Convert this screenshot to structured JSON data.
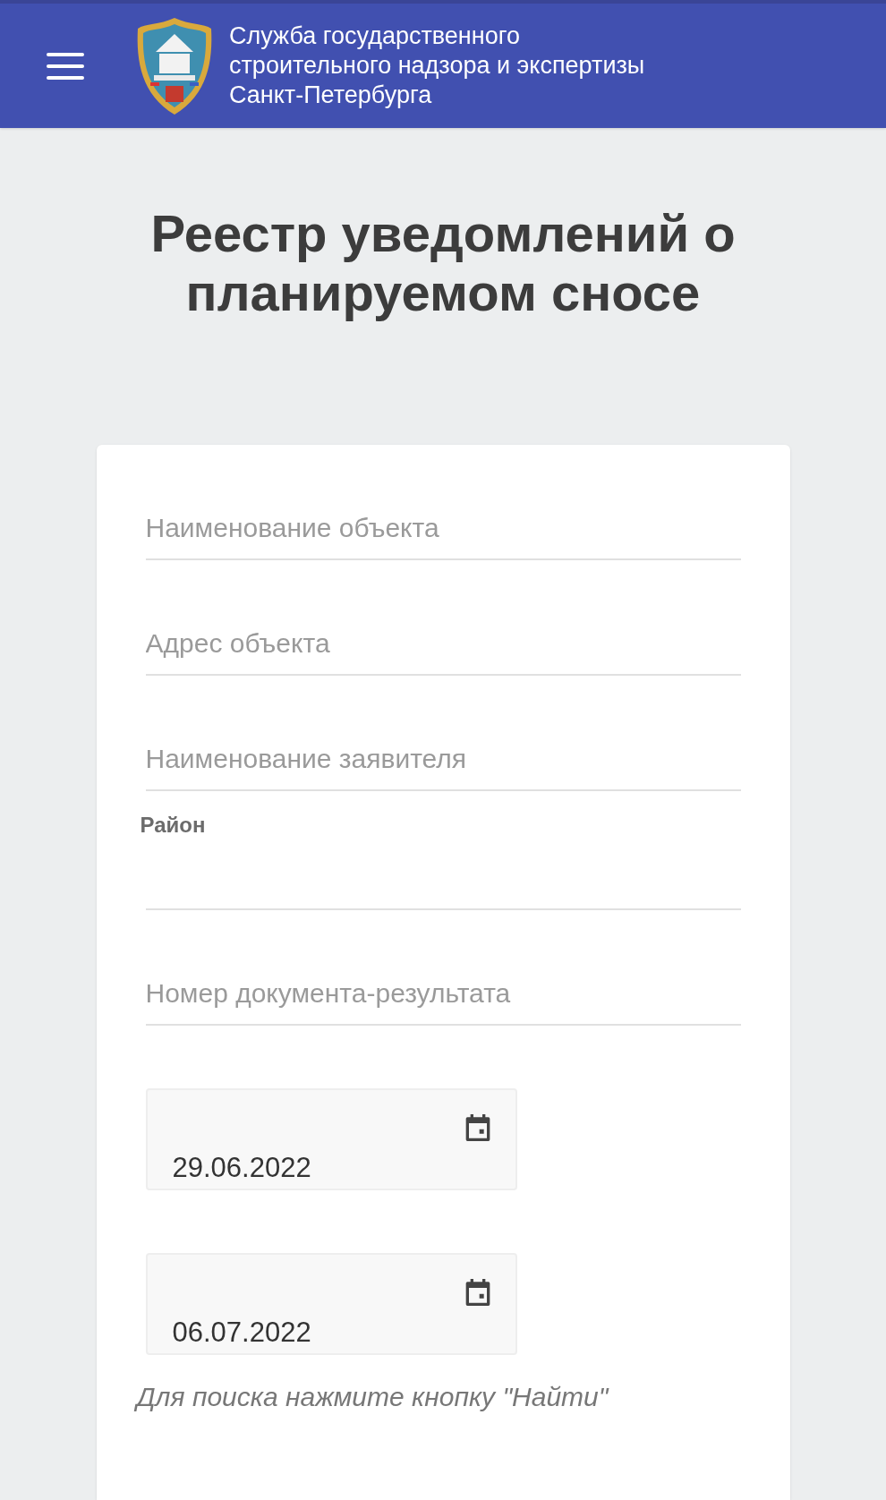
{
  "header": {
    "title_lines": [
      "Служба государственного",
      "строительного надзора и экспертизы",
      "Санкт-Петербурга"
    ]
  },
  "page_title": "Реестр уведомлений о планируемом сносе",
  "form": {
    "fields": [
      {
        "kind": "text",
        "placeholder": "Наименование объекта"
      },
      {
        "kind": "text",
        "placeholder": "Адрес объекта"
      },
      {
        "kind": "text",
        "placeholder": "Наименование заявителя"
      },
      {
        "kind": "select",
        "label": "Район"
      },
      {
        "kind": "text",
        "placeholder": "Номер документа-результата"
      },
      {
        "kind": "date",
        "value": "29.06.2022"
      },
      {
        "kind": "date",
        "value": "06.07.2022"
      }
    ],
    "hint": "Для поиска нажмите кнопку \"Найти\""
  }
}
